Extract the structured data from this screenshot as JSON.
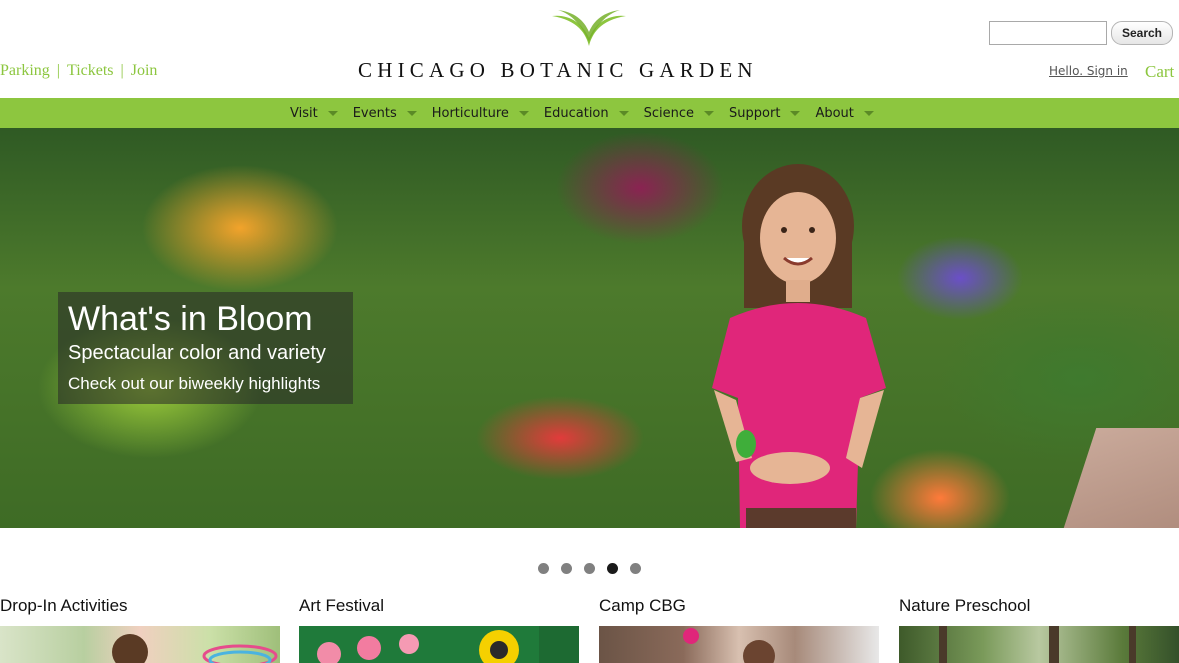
{
  "header": {
    "utility_links": [
      "Parking",
      "Tickets",
      "Join"
    ],
    "logo_text": "CHICAGO BOTANIC GARDEN",
    "search": {
      "placeholder": "",
      "button_label": "Search"
    },
    "signin_label": "Hello. Sign in",
    "cart_label": "Cart"
  },
  "nav": {
    "items": [
      {
        "label": "Visit"
      },
      {
        "label": "Events"
      },
      {
        "label": "Horticulture"
      },
      {
        "label": "Education"
      },
      {
        "label": "Science"
      },
      {
        "label": "Support"
      },
      {
        "label": "About"
      }
    ]
  },
  "hero": {
    "title": "What's in Bloom",
    "subtitle": "Spectacular color and variety",
    "link": "Check out our biweekly highlights",
    "slides_total": 5,
    "active_slide": 4
  },
  "features": [
    {
      "title": "Drop-In Activities",
      "image": "child-with-hula-hoops"
    },
    {
      "title": "Art Festival",
      "image": "paper-flowers-art"
    },
    {
      "title": "Camp CBG",
      "image": "kids-at-camp"
    },
    {
      "title": "Nature Preschool",
      "image": "trees-outdoors"
    }
  ],
  "colors": {
    "brand_green": "#8dc63f",
    "link_green": "#8cc63f",
    "dot_active": "#1a1a1a",
    "dot_inactive": "#808080"
  }
}
